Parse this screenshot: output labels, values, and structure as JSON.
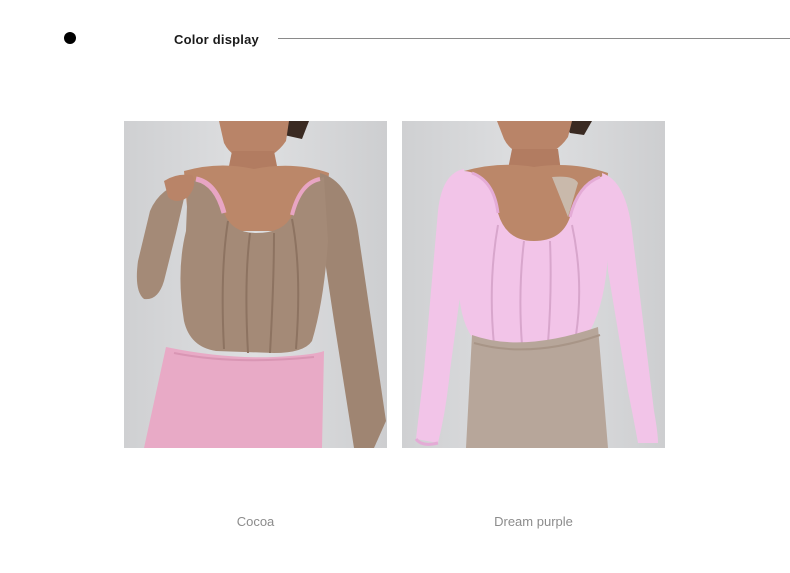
{
  "header": {
    "title": "Color display"
  },
  "variants": [
    {
      "label": "Cocoa",
      "top_color": "#a48a77",
      "bottom_color": "#e8aac6"
    },
    {
      "label": "Dream purple",
      "top_color": "#f2c4e8",
      "bottom_color": "#b7a69a"
    }
  ],
  "colors": {
    "background": "#ffffff",
    "photo_backdrop": "#d9dadc",
    "skin": "#b98468",
    "hair": "#3a2a22",
    "caption_text": "#8c8c8c",
    "rule_line": "#8a8a8a"
  }
}
